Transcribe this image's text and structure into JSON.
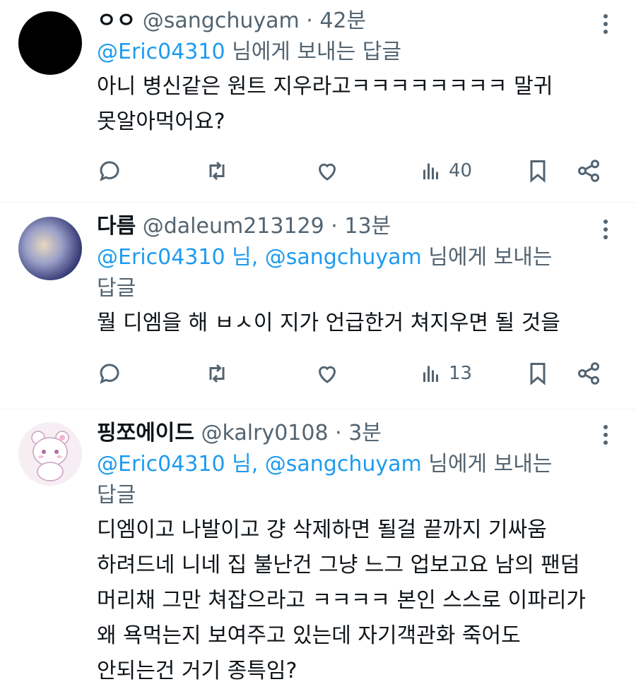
{
  "tweets": [
    {
      "name": "ㅇㅇ",
      "handle": "@sangchuyam",
      "time": "42분",
      "reply_mentions": "@Eric04310",
      "reply_rest": " 님에게 보내는 답글",
      "body_lines": [
        "아니 병신같은 원트 지우라고ㅋㅋㅋㅋㅋㅋㅋㅋ 말귀",
        "못알아먹어요?"
      ],
      "views": "40"
    },
    {
      "name": "다름",
      "handle": "@daleum213129",
      "time": "13분",
      "reply_mentions": "@Eric04310 님, @sangchuyam",
      "reply_rest": " 님에게 보내는",
      "reply_rest2": "답글",
      "body_lines": [
        "뭘 디엠을 해 ㅂㅅ이 지가 언급한거 쳐지우면 될 것을"
      ],
      "views": "13"
    },
    {
      "name": "핑쪼에이드",
      "handle": "@kalry0108",
      "time": "3분",
      "reply_mentions": "@Eric04310 님, @sangchuyam",
      "reply_rest": " 님에게 보내는",
      "reply_rest2": "답글",
      "body_lines": [
        "디엠이고 나발이고 걍 삭제하면 될걸 끝까지 기싸움",
        "하려드네 니네 집 불난건 그냥 느그 업보고요 남의 팬덤",
        "머리채 그만 쳐잡으라고 ㅋㅋㅋㅋ 본인 스스로 이파리가",
        "왜 욕먹는지 보여주고 있는데 자기객관화 죽어도",
        "안되는건 거기 종특임?"
      ]
    }
  ],
  "separator": "·",
  "icons": [
    "reply-icon",
    "retweet-icon",
    "like-icon",
    "views-icon",
    "bookmark-icon",
    "share-icon",
    "more-icon"
  ]
}
